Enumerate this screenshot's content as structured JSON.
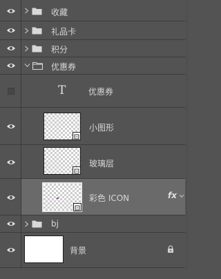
{
  "layers": [
    {
      "label": "收藏",
      "kind": "group",
      "visible": true,
      "expanded": false
    },
    {
      "label": "礼品卡",
      "kind": "group",
      "visible": true,
      "expanded": false
    },
    {
      "label": "积分",
      "kind": "group",
      "visible": true,
      "expanded": false
    },
    {
      "label": "优惠券",
      "kind": "group",
      "visible": true,
      "expanded": true
    },
    {
      "label": "优惠券",
      "kind": "text",
      "visible": false,
      "type_glyph": "T"
    },
    {
      "label": "小图形",
      "kind": "smart-object",
      "visible": true
    },
    {
      "label": "玻璃层",
      "kind": "smart-object",
      "visible": true
    },
    {
      "label": "彩色 ICON",
      "kind": "smart-object",
      "visible": true,
      "selected": true,
      "fx_label": "fx"
    },
    {
      "label": "bj",
      "kind": "group",
      "visible": true,
      "expanded": false
    },
    {
      "label": "背景",
      "kind": "background",
      "visible": true,
      "locked": true
    }
  ],
  "icons": {
    "eye": "eye-icon",
    "chevron_right": "chevron-right-icon",
    "chevron_down": "chevron-down-icon",
    "folder": "folder-icon",
    "lock": "lock-icon",
    "smart_object": "smart-object-icon",
    "fx": "fx-icon"
  },
  "colors": {
    "panel_bg": "#535353",
    "selected_row": "#6a6a6a",
    "divider": "#3b3b3b",
    "text": "#d6d6d6"
  }
}
